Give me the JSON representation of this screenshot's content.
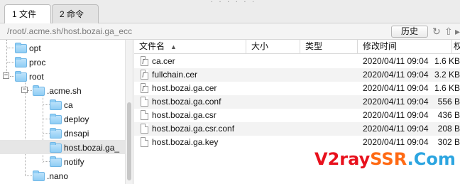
{
  "tabs": [
    {
      "label": "1 文件",
      "active": true
    },
    {
      "label": "2 命令",
      "active": false
    }
  ],
  "path_bar": {
    "path": "/root/.acme.sh/host.bozai.ga_ecc",
    "history_label": "历史",
    "refresh_icon": "refresh-icon",
    "up_icon": "up-icon"
  },
  "tree": [
    {
      "label": "opt",
      "expander": "",
      "level": 1
    },
    {
      "label": "proc",
      "expander": "",
      "level": 1
    },
    {
      "label": "root",
      "expander": "−",
      "level": 1
    },
    {
      "label": ".acme.sh",
      "expander": "−",
      "level": 2
    },
    {
      "label": "ca",
      "expander": "",
      "level": 3
    },
    {
      "label": "deploy",
      "expander": "",
      "level": 3
    },
    {
      "label": "dnsapi",
      "expander": "",
      "level": 3
    },
    {
      "label": "host.bozai.ga_",
      "expander": "",
      "level": 3,
      "selected": true
    },
    {
      "label": "notify",
      "expander": "",
      "level": 3
    },
    {
      "label": ".nano",
      "expander": "",
      "level": 2
    }
  ],
  "columns": {
    "name": "文件名",
    "size": "大小",
    "type": "类型",
    "modified": "修改时间",
    "extra": "权"
  },
  "files": [
    {
      "name": "ca.cer",
      "size": "1.6 KB",
      "type": "",
      "modified": "2020/04/11 09:04",
      "icon": "certificate-file-icon"
    },
    {
      "name": "fullchain.cer",
      "size": "3.2 KB",
      "type": "",
      "modified": "2020/04/11 09:04",
      "icon": "certificate-file-icon"
    },
    {
      "name": "host.bozai.ga.cer",
      "size": "1.6 KB",
      "type": "",
      "modified": "2020/04/11 09:04",
      "icon": "certificate-file-icon"
    },
    {
      "name": "host.bozai.ga.conf",
      "size": "556 B",
      "type": "",
      "modified": "2020/04/11 09:04",
      "icon": "file-icon"
    },
    {
      "name": "host.bozai.ga.csr",
      "size": "436 B",
      "type": "",
      "modified": "2020/04/11 09:04",
      "icon": "file-icon"
    },
    {
      "name": "host.bozai.ga.csr.conf",
      "size": "208 B",
      "type": "",
      "modified": "2020/04/11 09:04",
      "icon": "file-icon"
    },
    {
      "name": "host.bozai.ga.key",
      "size": "302 B",
      "type": "",
      "modified": "2020/04/11 09:04",
      "icon": "file-icon"
    }
  ],
  "watermark": {
    "part1": "V2ray",
    "part2": "SSR",
    "part3": ".Com"
  },
  "colors": {
    "folder": "#8fcdf4",
    "watermark_red": "#e8111d",
    "watermark_orange": "#ff6a14",
    "watermark_blue": "#2ca5e0"
  }
}
